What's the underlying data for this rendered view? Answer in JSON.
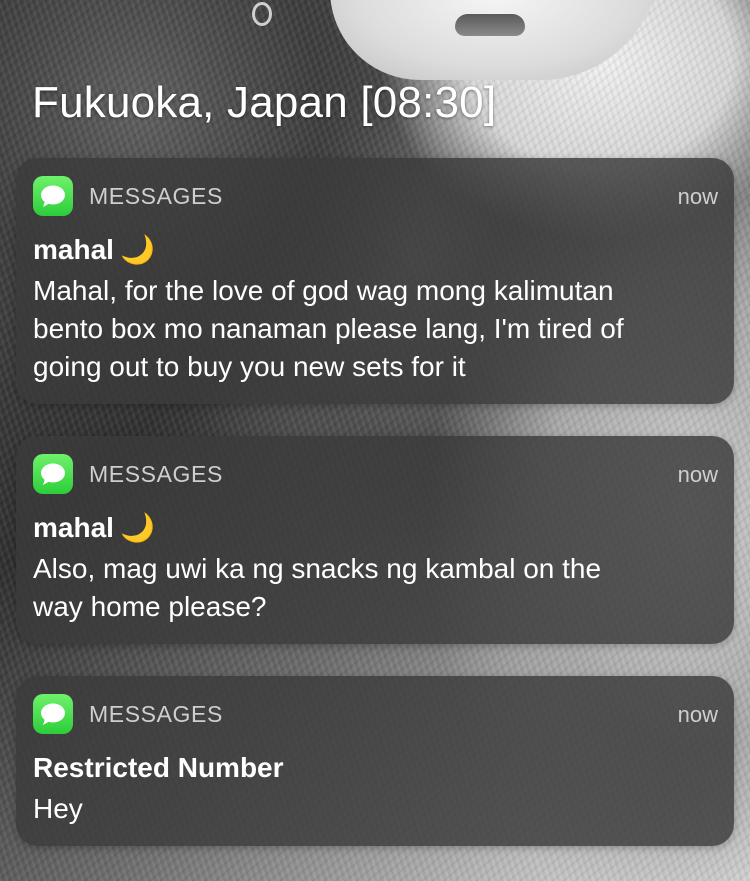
{
  "location_time": "Fukuoka, Japan [08:30]",
  "notifications": [
    {
      "app": "MESSAGES",
      "time": "now",
      "sender": "mahal",
      "sender_emoji": "🌙",
      "lines": [
        "Mahal, for the love of god wag mong kalimutan",
        "bento box mo nanaman please lang, I'm tired of",
        "going out to buy you new sets for it"
      ]
    },
    {
      "app": "MESSAGES",
      "time": "now",
      "sender": "mahal",
      "sender_emoji": "🌙",
      "lines": [
        "Also, mag uwi ka ng snacks ng kambal on the",
        "way home please?"
      ]
    },
    {
      "app": "MESSAGES",
      "time": "now",
      "sender": "Restricted Number",
      "lines": [
        "Hey"
      ]
    }
  ],
  "icons": {
    "app_icon": "messages-app-icon"
  },
  "colors": {
    "app_icon_green": "#34c759",
    "moon": "#f6c744"
  }
}
